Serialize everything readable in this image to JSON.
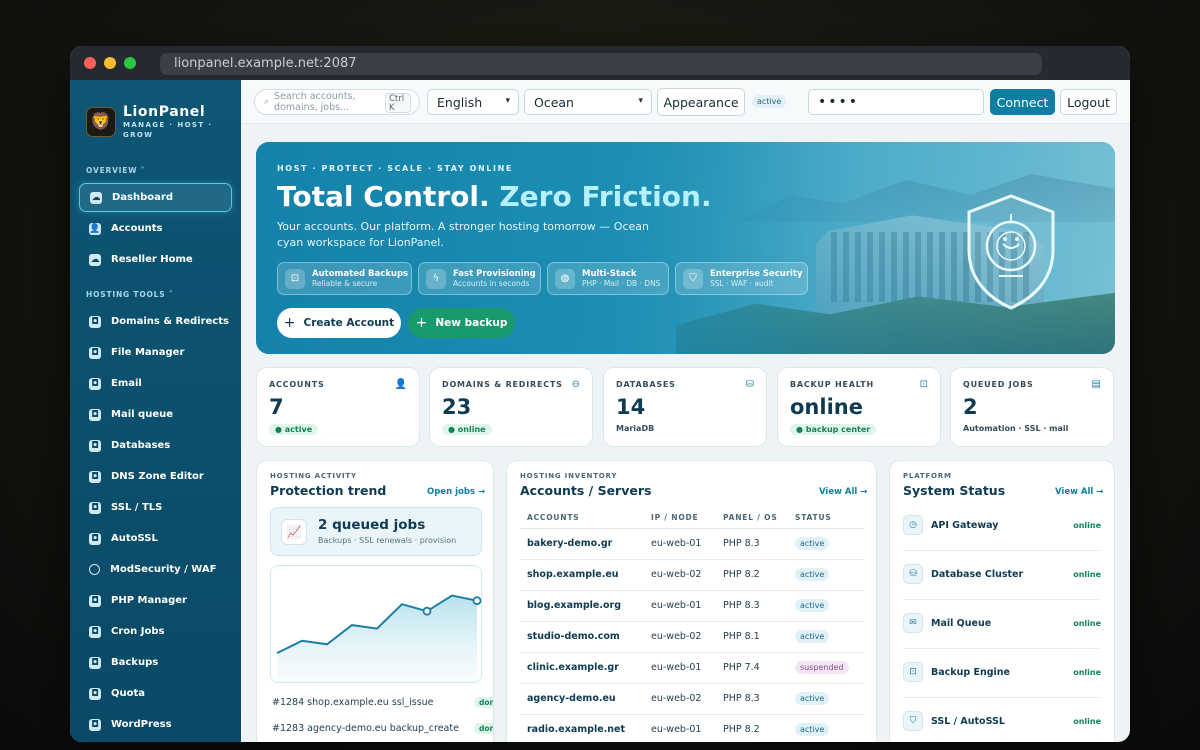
{
  "browser": {
    "url": "lionpanel.example.net:2087"
  },
  "brand": {
    "name": "LionPanel",
    "tagline": "MANAGE · HOST · GROW",
    "logo_icon": "lion-icon"
  },
  "sidebar": {
    "overview_label": "OVERVIEW ˅",
    "hosting_tools_label": "HOSTING TOOLS ˅",
    "overview_items": [
      {
        "label": "Dashboard",
        "icon": "cloud-icon",
        "active": true
      },
      {
        "label": "Accounts",
        "icon": "user-icon"
      },
      {
        "label": "Reseller Home",
        "icon": "cloud-icon"
      }
    ],
    "tool_items": [
      {
        "label": "Domains & Redirects"
      },
      {
        "label": "File Manager"
      },
      {
        "label": "Email"
      },
      {
        "label": "Mail queue"
      },
      {
        "label": "Databases"
      },
      {
        "label": "DNS Zone Editor"
      },
      {
        "label": "SSL / TLS"
      },
      {
        "label": "AutoSSL"
      },
      {
        "label": "ModSecurity / WAF"
      },
      {
        "label": "PHP Manager"
      },
      {
        "label": "Cron Jobs"
      },
      {
        "label": "Backups"
      },
      {
        "label": "Quota"
      },
      {
        "label": "WordPress"
      }
    ]
  },
  "topbar": {
    "search_placeholder": "Search accounts, domains, jobs...",
    "search_shortcut": "Ctrl K",
    "language": "English",
    "theme": "Ocean",
    "appearance_label": "Appearance",
    "appearance_badge": "active",
    "password_value": "••••",
    "connect_label": "Connect",
    "logout_label": "Logout"
  },
  "hero": {
    "kicker": "HOST · PROTECT · SCALE · STAY ONLINE",
    "title_main": "Total Control.",
    "title_accent": "Zero Friction.",
    "description": "Your accounts. Our platform. A stronger hosting tomorrow — Ocean cyan workspace for LionPanel.",
    "features": [
      {
        "title": "Automated Backups",
        "subtitle": "Reliable & secure",
        "icon": "backup-icon"
      },
      {
        "title": "Fast Provisioning",
        "subtitle": "Accounts in seconds",
        "icon": "bolt-icon"
      },
      {
        "title": "Multi-Stack",
        "subtitle": "PHP · Mail · DB · DNS",
        "icon": "globe-icon"
      },
      {
        "title": "Enterprise Security",
        "subtitle": "SSL · WAF · audit",
        "icon": "shield-icon"
      }
    ],
    "create_account_label": "Create Account",
    "new_backup_label": "New backup"
  },
  "stats": [
    {
      "label": "ACCOUNTS",
      "value": "7",
      "badge": "● active",
      "icon": "user-icon"
    },
    {
      "label": "DOMAINS & REDIRECTS",
      "value": "23",
      "badge": "● online",
      "icon": "globe-icon"
    },
    {
      "label": "DATABASES",
      "value": "14",
      "sub": "MariaDB",
      "icon": "database-icon"
    },
    {
      "label": "BACKUP HEALTH",
      "value": "online",
      "badge": "● backup center",
      "icon": "backup-icon"
    },
    {
      "label": "QUEUED JOBS",
      "value": "2",
      "sub": "Automation · SSL · mail",
      "icon": "clipboard-icon"
    }
  ],
  "activity": {
    "kicker": "HOSTING ACTIVITY",
    "title": "Protection trend",
    "link": "Open jobs →",
    "queued_title": "2 queued jobs",
    "queued_sub": "Backups · SSL renewals · provision",
    "jobs": [
      {
        "id": "#1284",
        "domain": "shop.example.eu",
        "action": "ssl_issue",
        "status": "done"
      },
      {
        "id": "#1283",
        "domain": "agency-demo.eu",
        "action": "backup_create",
        "status": "done"
      }
    ]
  },
  "chart_data": {
    "type": "area",
    "title": "",
    "xlabel": "",
    "ylabel": "",
    "x": [
      1,
      2,
      3,
      4,
      5,
      6,
      7,
      8,
      9
    ],
    "values": [
      12,
      19,
      17,
      28,
      26,
      40,
      36,
      45,
      42
    ],
    "highlighted_points": [
      6,
      8
    ],
    "ylim": [
      0,
      55
    ],
    "grid": false,
    "accent": "#1b7fa3"
  },
  "inventory": {
    "kicker": "HOSTING INVENTORY",
    "title": "Accounts / Servers",
    "link": "View All →",
    "columns": [
      "ACCOUNTS",
      "IP / NODE",
      "PANEL / OS",
      "STATUS"
    ],
    "rows": [
      [
        "bakery-demo.gr",
        "eu-web-01",
        "PHP 8.3",
        "active"
      ],
      [
        "shop.example.eu",
        "eu-web-02",
        "PHP 8.2",
        "active"
      ],
      [
        "blog.example.org",
        "eu-web-01",
        "PHP 8.3",
        "active"
      ],
      [
        "studio-demo.com",
        "eu-web-02",
        "PHP 8.1",
        "active"
      ],
      [
        "clinic.example.gr",
        "eu-web-01",
        "PHP 7.4",
        "suspended"
      ],
      [
        "agency-demo.eu",
        "eu-web-02",
        "PHP 8.3",
        "active"
      ],
      [
        "radio.example.net",
        "eu-web-01",
        "PHP 8.2",
        "active"
      ]
    ]
  },
  "platform": {
    "kicker": "PLATFORM",
    "title": "System Status",
    "link": "View All →",
    "services": [
      {
        "name": "API Gateway",
        "status": "online",
        "icon": "clock-icon"
      },
      {
        "name": "Database Cluster",
        "status": "online",
        "icon": "database-icon"
      },
      {
        "name": "Mail Queue",
        "status": "online",
        "icon": "mail-icon"
      },
      {
        "name": "Backup Engine",
        "status": "online",
        "icon": "backup-icon"
      },
      {
        "name": "SSL / AutoSSL",
        "status": "online",
        "icon": "shield-icon"
      }
    ]
  },
  "colors": {
    "accent": "#0e7ea3",
    "sidebar": "#0d5674",
    "success": "#178257"
  }
}
